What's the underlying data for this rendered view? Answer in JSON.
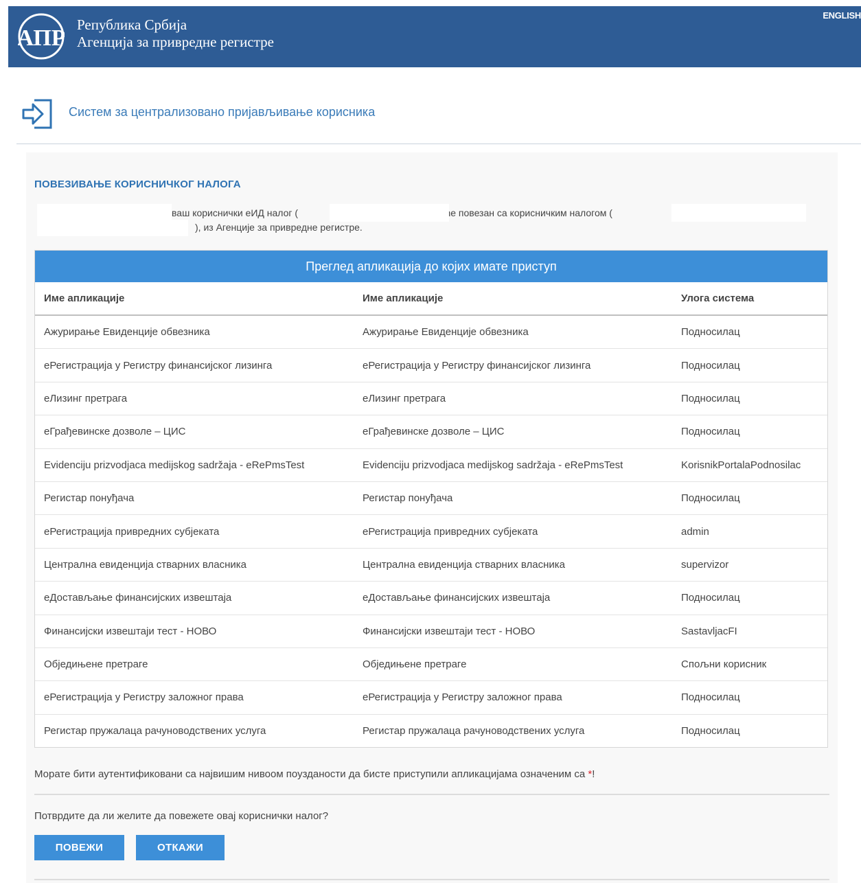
{
  "header": {
    "brand_line1": "Република Србија",
    "brand_line2": "Агенција за привредне регистре",
    "language_link": "ENGLISH",
    "logo_text": "АПР",
    "background_color": "#2e5c95"
  },
  "subheader": {
    "system_title": "Систем за централизовано пријављивање корисника",
    "icon": "login-arrow-icon"
  },
  "section": {
    "title": "ПОВЕЗИВАЊЕ КОРИСНИЧКОГ НАЛОГА",
    "info_part1": "ваш кориснички еИД налог (",
    "info_part2": ") биће повезан са корисничким налогом (",
    "info_part3": "), из Агенције за привредне регистре."
  },
  "table": {
    "caption": "Преглед апликација до којих имате приступ",
    "columns": [
      "Име апликације",
      "Име апликације",
      "Улога система"
    ],
    "rows": [
      [
        "Ажурирање Евиденције обвезника",
        "Ажурирање Евиденције обвезника",
        "Подносилац"
      ],
      [
        "еРегистрација у Регистру финансијског лизинга",
        "еРегистрација у Регистру финансијског лизинга",
        "Подносилац"
      ],
      [
        "еЛизинг претрага",
        "еЛизинг претрага",
        "Подносилац"
      ],
      [
        "еГрађевинске дозволе – ЦИС",
        "еГрађевинске дозволе – ЦИС",
        "Подносилац"
      ],
      [
        "Evidenciju prizvodjaca medijskog sadržaja - eRePmsTest",
        "Evidenciju prizvodjaca medijskog sadržaja - eRePmsTest",
        "KorisnikPortalaPodnosilac"
      ],
      [
        "Регистар понуђача",
        "Регистар понуђача",
        "Подносилац"
      ],
      [
        "еРегистрација привредних субјеката",
        "еРегистрација привредних субјеката",
        "admin"
      ],
      [
        "Централна евиденција стварних власника",
        "Централна евиденција стварних власника",
        "supervizor"
      ],
      [
        "еДостављање финансијских извештаја",
        "еДостављање финансијских извештаја",
        "Подносилац"
      ],
      [
        "Финансијски извештаји тест - НОВО",
        "Финансијски извештаји тест - НОВО",
        "SastavljacFI"
      ],
      [
        "Обједињене претраге",
        "Обједињене претраге",
        "Спољни корисник"
      ],
      [
        "еРегистрација у Регистру заложног права",
        "еРегистрација у Регистру заложног права",
        "Подносилац"
      ],
      [
        "Регистар пружалаца рачуноводствених услуга",
        "Регистар пружалаца рачуноводствених услуга",
        "Подносилац"
      ]
    ],
    "caption_color": "#3d8fd8"
  },
  "notice": {
    "text": "Морате бити аутентификовани са највишим нивоом поузданости да бисте приступили апликацијама означеним са ",
    "star": "*",
    "end": "!"
  },
  "confirm": {
    "question": "Потврдите да ли желите да повежете овај кориснички налог?",
    "connect_label": "ПОВЕЖИ",
    "cancel_label": "ОТКАЖИ"
  }
}
